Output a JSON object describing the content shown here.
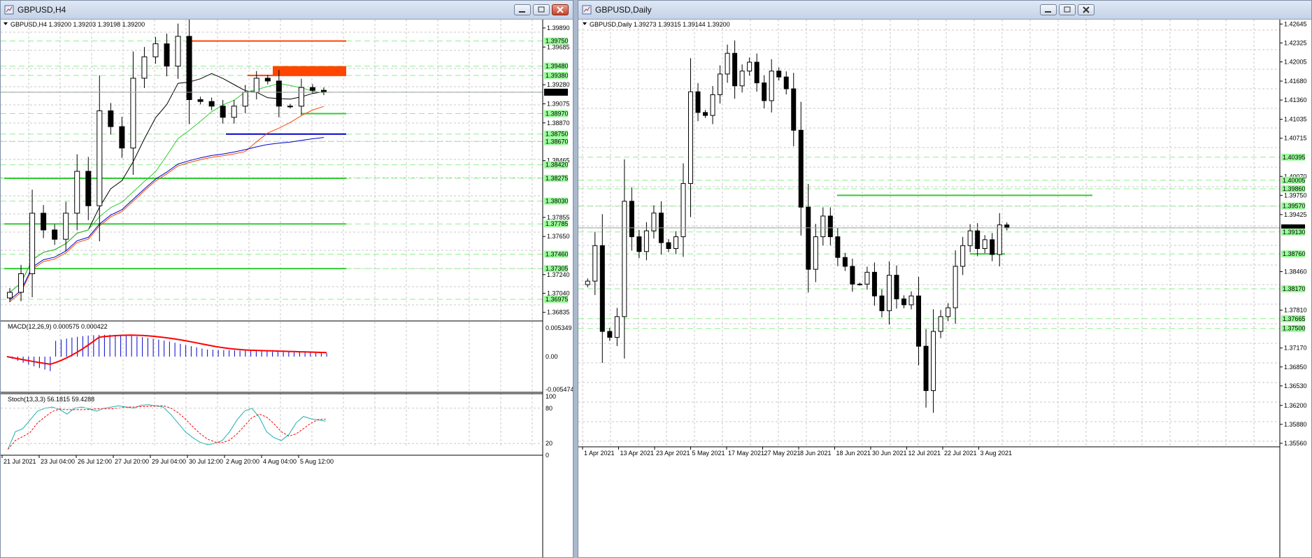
{
  "left_window": {
    "title": "GBPUSD,H4",
    "header_info": "GBPUSD,H4  1.39200 1.39203 1.39198 1.39200",
    "price_ticks": [
      "1.39890",
      "1.39685",
      "1.39280",
      "1.39075",
      "1.38870",
      "1.38465",
      "1.37855",
      "1.37650",
      "1.37240",
      "1.37040",
      "1.36835"
    ],
    "level_tags": [
      "1.39750",
      "1.39480",
      "1.39380",
      "1.39200",
      "1.38970",
      "1.38750",
      "1.38670",
      "1.38420",
      "1.38275",
      "1.38030",
      "1.37785",
      "1.37460",
      "1.37305",
      "1.36975"
    ],
    "time_labels": [
      "21 Jul 2021",
      "23 Jul 04:00",
      "26 Jul 12:00",
      "27 Jul 20:00",
      "29 Jul 04:00",
      "30 Jul 12:00",
      "2 Aug 20:00",
      "4 Aug 04:00",
      "5 Aug 12:00"
    ],
    "macd_label": "MACD(12,26,9) 0.000575 0.000422",
    "macd_ticks": [
      "0.005349",
      "0.00",
      "-0.005474"
    ],
    "stoch_label": "Stoch(13,3,3) 56.1815 59.4288",
    "stoch_ticks": [
      "100",
      "80",
      "20",
      "0"
    ]
  },
  "right_window": {
    "title": "GBPUSD,Daily",
    "header_info": "GBPUSD,Daily  1.39273 1.39315 1.39144 1.39200",
    "price_ticks": [
      "1.42645",
      "1.42325",
      "1.42005",
      "1.41680",
      "1.41360",
      "1.41035",
      "1.40715",
      "1.40070",
      "1.39750",
      "1.39425",
      "1.38460",
      "1.37810",
      "1.37170",
      "1.36850",
      "1.36530",
      "1.36200",
      "1.35880",
      "1.35560"
    ],
    "level_tags": [
      "1.40395",
      "1.40005",
      "1.39860",
      "1.39570",
      "1.39200",
      "1.39130",
      "1.38760",
      "1.38170",
      "1.37665",
      "1.37500"
    ],
    "time_labels": [
      "1 Apr 2021",
      "13 Apr 2021",
      "23 Apr 2021",
      "5 May 2021",
      "17 May 2021",
      "27 May 2021",
      "8 Jun 2021",
      "18 Jun 2021",
      "30 Jun 2021",
      "12 Jul 2021",
      "22 Jul 2021",
      "3 Aug 2021"
    ]
  },
  "colors": {
    "bull_candle": "#ffffff",
    "bear_candle": "#000000",
    "support_line": "#32cd32",
    "resistance_zone": "#ff4500",
    "macd_hist": "#0000cd",
    "macd_signal": "#ff0000",
    "ma_blue": "#0000cd",
    "ma_red": "#ff4500",
    "ma_black": "#000000",
    "ma_green": "#32cd32",
    "tag_bg": "#98fb98",
    "current_price_tag": "#000000"
  },
  "chart_data": [
    {
      "type": "line",
      "title": "GBPUSD,H4",
      "series": [
        {
          "name": "GBPUSD",
          "values": [
            1.3705,
            1.3725,
            1.379,
            1.3772,
            1.3762,
            1.379,
            1.3835,
            1.3798,
            1.39,
            1.3883,
            1.386,
            1.3935,
            1.3958,
            1.3972,
            1.3948,
            1.398,
            1.3912,
            1.391,
            1.3905,
            1.3893,
            1.3905,
            1.392,
            1.3935,
            1.3932,
            1.3905,
            1.3905,
            1.3925,
            1.3922,
            1.392
          ]
        }
      ],
      "ylim": [
        1.3675,
        1.3998
      ],
      "horizontal_levels": [
        1.3975,
        1.3948,
        1.3938,
        1.3897,
        1.3875,
        1.38275,
        1.37785,
        1.37305
      ]
    },
    {
      "type": "line",
      "title": "GBPUSD,Daily",
      "series": [
        {
          "name": "GBPUSD",
          "values": [
            1.383,
            1.389,
            1.3745,
            1.3735,
            1.377,
            1.3965,
            1.3905,
            1.388,
            1.3915,
            1.3945,
            1.3895,
            1.3885,
            1.3905,
            1.3995,
            1.415,
            1.4115,
            1.411,
            1.4145,
            1.418,
            1.4215,
            1.416,
            1.4185,
            1.42,
            1.4165,
            1.4135,
            1.4185,
            1.4175,
            1.4155,
            1.4085,
            1.3955,
            1.385,
            1.3905,
            1.394,
            1.3905,
            1.387,
            1.3855,
            1.3825,
            1.3825,
            1.3845,
            1.3805,
            1.378,
            1.384,
            1.38,
            1.379,
            1.3805,
            1.372,
            1.3645,
            1.3745,
            1.377,
            1.3785,
            1.3855,
            1.389,
            1.3915,
            1.3885,
            1.39,
            1.3875,
            1.3925,
            1.392
          ]
        }
      ],
      "ylim": [
        1.355,
        1.4272
      ],
      "horizontal_levels": [
        1.3975,
        1.3876
      ]
    }
  ]
}
